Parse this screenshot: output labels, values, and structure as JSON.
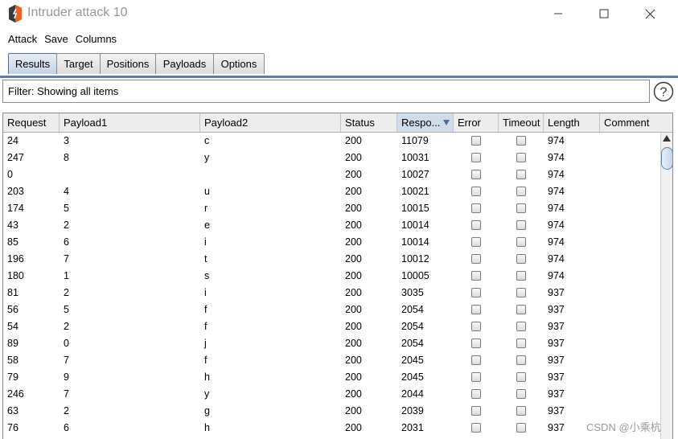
{
  "window": {
    "title": "Intruder attack 10"
  },
  "menu": [
    "Attack",
    "Save",
    "Columns"
  ],
  "tabs": [
    "Results",
    "Target",
    "Positions",
    "Payloads",
    "Options"
  ],
  "active_tab": "Results",
  "filter": {
    "text": "Filter: Showing all items"
  },
  "table": {
    "columns": [
      "Request",
      "Payload1",
      "Payload2",
      "Status",
      "Respo...",
      "Error",
      "Timeout",
      "Length",
      "Comment"
    ],
    "sorted_column": "Respo...",
    "rows": [
      {
        "request": "24",
        "payload1": "3",
        "payload2": "c",
        "status": "200",
        "response": "11079",
        "length": "974"
      },
      {
        "request": "247",
        "payload1": "8",
        "payload2": "y",
        "status": "200",
        "response": "10031",
        "length": "974"
      },
      {
        "request": "0",
        "payload1": "",
        "payload2": "",
        "status": "200",
        "response": "10027",
        "length": "974"
      },
      {
        "request": "203",
        "payload1": "4",
        "payload2": "u",
        "status": "200",
        "response": "10021",
        "length": "974"
      },
      {
        "request": "174",
        "payload1": "5",
        "payload2": "r",
        "status": "200",
        "response": "10015",
        "length": "974"
      },
      {
        "request": "43",
        "payload1": "2",
        "payload2": "e",
        "status": "200",
        "response": "10014",
        "length": "974"
      },
      {
        "request": "85",
        "payload1": "6",
        "payload2": "i",
        "status": "200",
        "response": "10014",
        "length": "974"
      },
      {
        "request": "196",
        "payload1": "7",
        "payload2": "t",
        "status": "200",
        "response": "10012",
        "length": "974"
      },
      {
        "request": "180",
        "payload1": "1",
        "payload2": "s",
        "status": "200",
        "response": "10005",
        "length": "974"
      },
      {
        "request": "81",
        "payload1": "2",
        "payload2": "i",
        "status": "200",
        "response": "3035",
        "length": "937"
      },
      {
        "request": "56",
        "payload1": "5",
        "payload2": "f",
        "status": "200",
        "response": "2054",
        "length": "937"
      },
      {
        "request": "54",
        "payload1": "2",
        "payload2": "f",
        "status": "200",
        "response": "2054",
        "length": "937"
      },
      {
        "request": "89",
        "payload1": "0",
        "payload2": "j",
        "status": "200",
        "response": "2054",
        "length": "937"
      },
      {
        "request": "58",
        "payload1": "7",
        "payload2": "f",
        "status": "200",
        "response": "2045",
        "length": "937"
      },
      {
        "request": "79",
        "payload1": "9",
        "payload2": "h",
        "status": "200",
        "response": "2045",
        "length": "937"
      },
      {
        "request": "246",
        "payload1": "7",
        "payload2": "y",
        "status": "200",
        "response": "2044",
        "length": "937"
      },
      {
        "request": "63",
        "payload1": "2",
        "payload2": "g",
        "status": "200",
        "response": "2039",
        "length": "937"
      },
      {
        "request": "76",
        "payload1": "6",
        "payload2": "h",
        "status": "200",
        "response": "2031",
        "length": "937"
      }
    ]
  },
  "watermark": "CSDN @小乘杭",
  "colors": {
    "accent": "#5a7fa6",
    "sorted_header": "#cfdcea",
    "logo_orange": "#e8622a"
  }
}
